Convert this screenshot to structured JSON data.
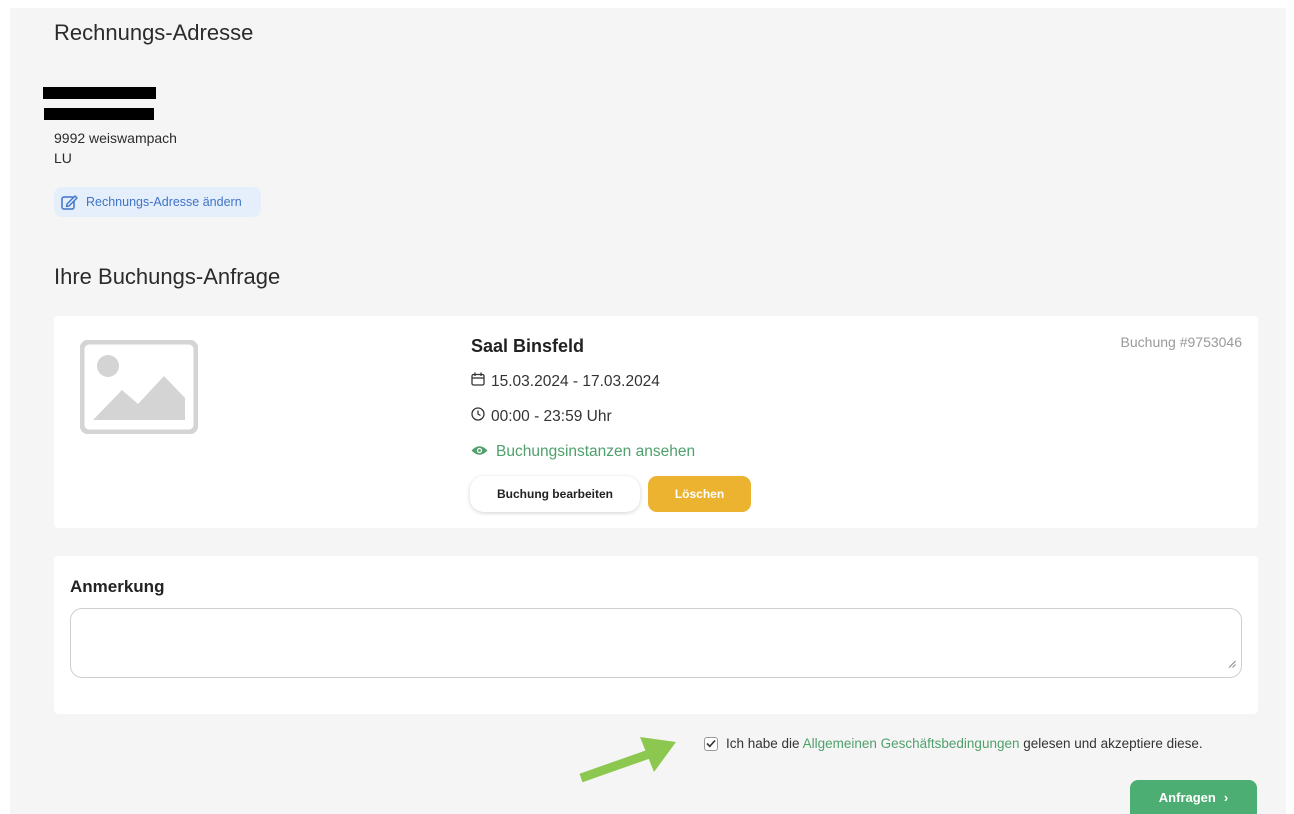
{
  "billing": {
    "heading": "Rechnungs-Adresse",
    "address_lines": [
      "9992 weiswampach",
      "LU"
    ],
    "edit_label": "Rechnungs-Adresse ändern"
  },
  "booking": {
    "heading": "Ihre Buchungs-Anfrage",
    "venue_name": "Saal Binsfeld",
    "booking_id": "Buchung #9753046",
    "date_range": "15.03.2024 - 17.03.2024",
    "time_range": "00:00 - 23:59 Uhr",
    "instances_link": "Buchungsinstanzen ansehen",
    "edit_button": "Buchung bearbeiten",
    "delete_button": "Löschen"
  },
  "note": {
    "label": "Anmerkung",
    "value": ""
  },
  "terms": {
    "checked": true,
    "prefix": "Ich habe die",
    "link_text": "Allgemeinen Geschäftsbedingungen",
    "suffix": "gelesen und akzeptiere diese."
  },
  "submit": {
    "label": "Anfragen",
    "chevron": "›"
  },
  "icons": {
    "edit": "pencil-square-icon",
    "date": "calendar-icon",
    "time": "clock-icon",
    "view": "eye-icon",
    "thumb": "image-placeholder-icon",
    "annotation": "arrow-annotation-icon"
  },
  "colors": {
    "accent_green": "#4cae72",
    "link_green": "#4fa06c",
    "delete_yellow": "#ebb330",
    "edit_blue": "#3f73c8",
    "arrow_green": "#8cc850"
  }
}
